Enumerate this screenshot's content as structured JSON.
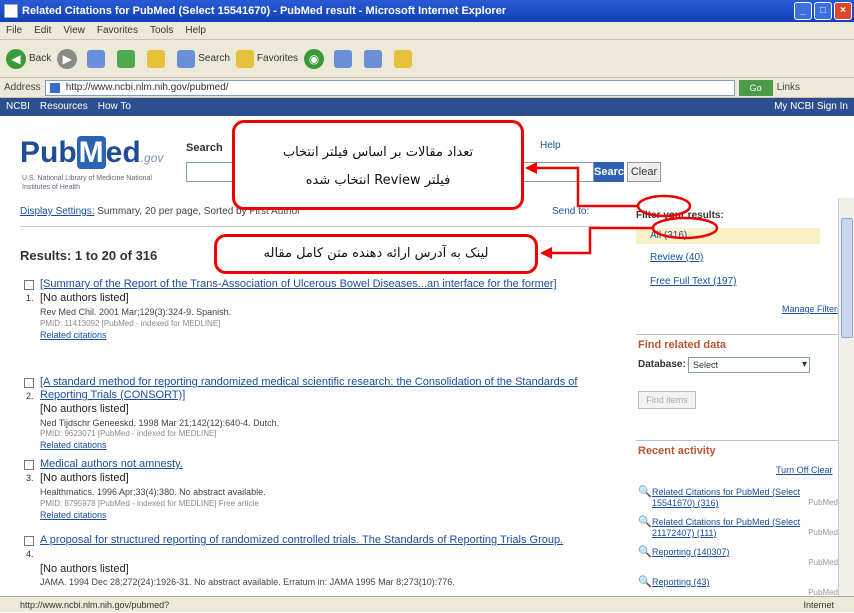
{
  "window": {
    "title": "Related Citations for PubMed (Select 15541670) - PubMed result - Microsoft Internet Explorer"
  },
  "menu": [
    "File",
    "Edit",
    "View",
    "Favorites",
    "Tools",
    "Help"
  ],
  "toolbar": {
    "back": "Back",
    "search": "Search",
    "favorites": "Favorites"
  },
  "address": {
    "label": "Address",
    "url": "http://www.ncbi.nlm.nih.gov/pubmed/",
    "go": "Go",
    "links": "Links"
  },
  "ncbi": {
    "left": "NCBI",
    "resources": "Resources",
    "howto": "How To",
    "right": "My NCBI  Sign In"
  },
  "pubmed": {
    "logo_pub": "Pub",
    "logo_m": "M",
    "logo_ed": "ed",
    "logo_gov": ".gov",
    "sub": "U.S. National Library of Medicine National Institutes of Health",
    "search_label": "Search",
    "search_btn": "Search",
    "clear_btn": "Clear",
    "help": "Help"
  },
  "display": {
    "settings": "Display Settings:",
    "summary": "Summary, 20 per page, Sorted by First Author",
    "send_to": "Send to:"
  },
  "results_label": "Results: 1 to 20 of 316",
  "items": [
    {
      "num": "1.",
      "title": "[Summary of the Report of the Trans-Association of Ulcerous Bowel Diseases...an interface for the former]",
      "authors": "[No authors listed]",
      "journal": "Rev Med Chil. 2001 Mar;129(3):324-9. Spanish.",
      "pmid": "PMID: 11413092 [PubMed - indexed for MEDLINE]",
      "related": "Related citations"
    },
    {
      "num": "2.",
      "title": "[A standard method for reporting randomized medical scientific research: the Consolidation of the Standards of Reporting Trials (CONSORT)]",
      "authors": "[No authors listed]",
      "journal": "Ned Tijdschr Geneeskd. 1998 Mar 21;142(12):640-4. Dutch.",
      "pmid": "PMID: 9623071 [PubMed - indexed for MEDLINE]",
      "related": "Related citations"
    },
    {
      "num": "3.",
      "title": "Medical authors not amnesty.",
      "authors": "[No authors listed]",
      "journal": "Healthmatics. 1996 Apr;33(4):380. No abstract available.",
      "pmid": "PMID: 8795978 [PubMed - indexed for MEDLINE]  Free article",
      "related": "Related citations"
    },
    {
      "num": "4.",
      "title": "A proposal for structured reporting of randomized controlled trials. The Standards of Reporting Trials Group.",
      "authors": "[No authors listed]",
      "journal": "JAMA. 1994 Dec 28;272(24):1926-31. No abstract available. Erratum in: JAMA 1995 Mar 8;273(10):776.",
      "pmid": "",
      "related": ""
    }
  ],
  "sidebar": {
    "filter_title": "Filter your results:",
    "filters": [
      "All (316)",
      "Review (40)",
      "Free Full Text (197)"
    ],
    "manage": "Manage Filters",
    "related_title": "Find related data",
    "database_label": "Database:",
    "database_value": "Select",
    "find_btn": "Find items",
    "activity_title": "Recent activity",
    "activity_turnoff": "Turn Off  Clear",
    "activity": [
      {
        "text": "Related Citations for PubMed (Select 15541670) (316)",
        "kind": "PubMed"
      },
      {
        "text": "Related Citations for PubMed (Select 21172407) (111)",
        "kind": "PubMed"
      },
      {
        "text": "Reporting (140307)",
        "kind": "PubMed"
      },
      {
        "text": "Reporting (43)",
        "kind": "PubMed"
      }
    ]
  },
  "status": {
    "left": "http://www.ncbi.nlm.nih.gov/pubmed?",
    "right": "Internet"
  },
  "callouts": {
    "top_line1": "تعداد مقالات بر اساس فیلتر انتخاب",
    "top_line2": "فیلتر Review انتخاب شده",
    "bottom": "لینک به آدرس ارائه دهنده متن کامل مقاله"
  },
  "colors": {
    "annotation": "#e00000",
    "titlebar": "#1f4fc8"
  }
}
